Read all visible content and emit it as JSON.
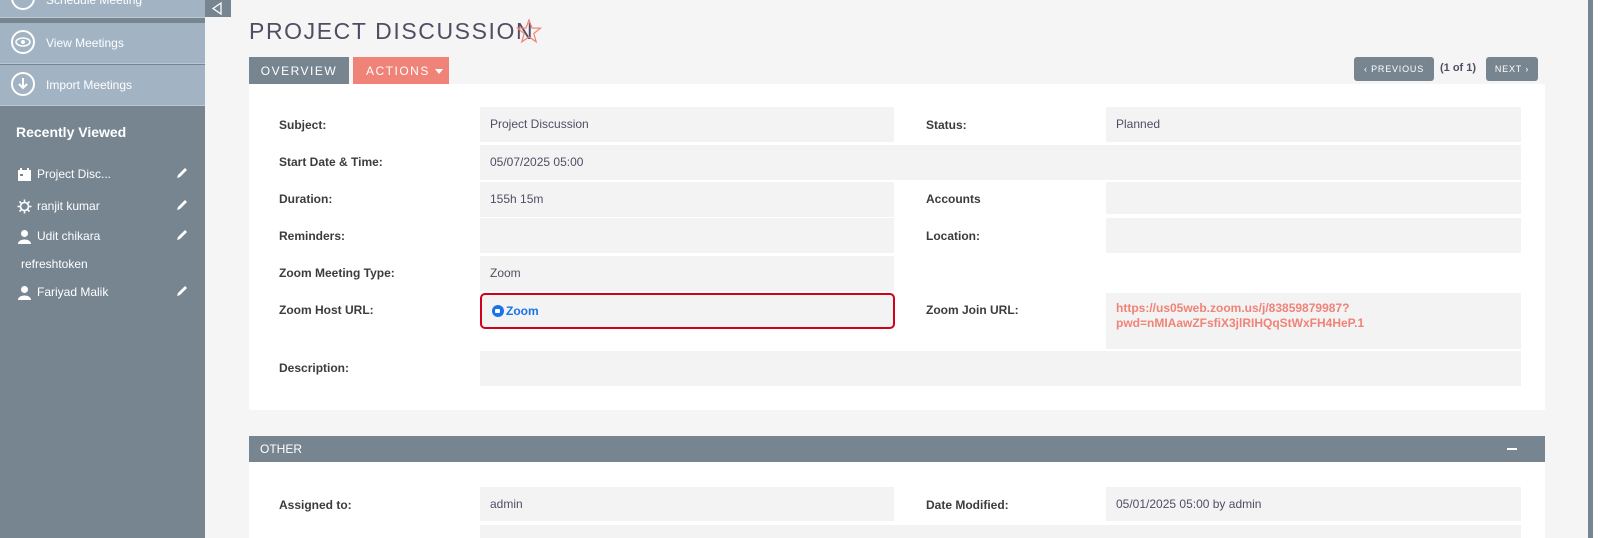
{
  "sidebar": {
    "actions": [
      {
        "label": "Schedule Meeting",
        "icon": "calendar-icon"
      },
      {
        "label": "View Meetings",
        "icon": "eye-icon"
      },
      {
        "label": "Import Meetings",
        "icon": "download-icon"
      }
    ],
    "recently_viewed_title": "Recently Viewed",
    "recent_items": [
      {
        "label": "Project Disc...",
        "icon": "calendar-icon"
      },
      {
        "label": "ranjit kumar",
        "icon": "gear-icon"
      },
      {
        "label": "Udit chikara",
        "icon": "user-icon"
      },
      {
        "label": "refreshtoken",
        "icon": ""
      },
      {
        "label": "Fariyad Malik",
        "icon": "user-icon"
      }
    ]
  },
  "header": {
    "title": "PROJECT DISCUSSION"
  },
  "tabs": {
    "overview": "OVERVIEW",
    "actions": "ACTIONS"
  },
  "pagination": {
    "previous": "PREVIOUS",
    "info": "(1 of 1)",
    "next": "NEXT"
  },
  "fields": {
    "subject": {
      "label": "Subject:",
      "value": "Project Discussion"
    },
    "status": {
      "label": "Status:",
      "value": "Planned"
    },
    "start": {
      "label": "Start Date & Time:",
      "value": "05/07/2025 05:00"
    },
    "duration": {
      "label": "Duration:",
      "value": "155h 15m"
    },
    "accounts": {
      "label": "Accounts",
      "value": ""
    },
    "reminders": {
      "label": "Reminders:",
      "value": ""
    },
    "location": {
      "label": "Location:",
      "value": ""
    },
    "zoom_type": {
      "label": "Zoom Meeting Type:",
      "value": "Zoom"
    },
    "zoom_host": {
      "label": "Zoom Host URL:",
      "value": "Zoom"
    },
    "zoom_join": {
      "label": "Zoom Join URL:",
      "value_line1": "https://us05web.zoom.us/j/83859879987?",
      "value_line2": "pwd=nMIAawZFsfiX3jlRIHQqStWxFH4HeP.1"
    },
    "description": {
      "label": "Description:",
      "value": ""
    }
  },
  "other": {
    "title": "OTHER",
    "assigned": {
      "label": "Assigned to:",
      "value": "admin"
    },
    "modified": {
      "label": "Date Modified:",
      "value": "05/01/2025 05:00 by admin"
    }
  },
  "colors": {
    "accent": "#f08377",
    "sidebar": "#778591",
    "highlight": "#d0021b",
    "zoom": "#1a73e8"
  }
}
